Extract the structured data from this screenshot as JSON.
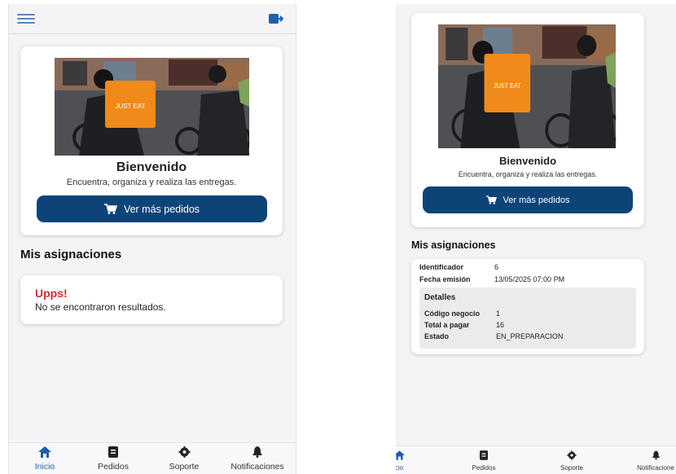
{
  "left": {
    "welcome": "Bienvenido",
    "subtitle": "Encuentra, organiza y realiza las entregas.",
    "cta": "Ver más pedidos",
    "section_title": "Mis asignaciones",
    "empty_title": "Upps!",
    "empty_text": "No se encontraron resultados.",
    "nav": [
      {
        "label": "Inicio",
        "icon": "home-icon",
        "active": true
      },
      {
        "label": "Pedidos",
        "icon": "document-icon",
        "active": false
      },
      {
        "label": "Soporte",
        "icon": "gear-icon",
        "active": false
      },
      {
        "label": "Notificaciones",
        "icon": "bell-icon",
        "active": false
      }
    ]
  },
  "right": {
    "welcome": "Bienvenido",
    "subtitle": "Encuentra, organiza y realiza las entregas.",
    "cta": "Ver más pedidos",
    "section_title": "Mis asignaciones",
    "assignment": {
      "id_label": "Identificador",
      "id_value": "6",
      "date_label": "Fecha emisión",
      "date_value": "13/05/2025 07:00 PM",
      "details_title": "Detalles",
      "code_label": "Código negocio",
      "code_value": "1",
      "total_label": "Total a pagar",
      "total_value": "16",
      "status_label": "Estado",
      "status_value": "EN_PREPARACION"
    },
    "nav": [
      {
        "label": "cio",
        "icon": "home-icon",
        "active": true
      },
      {
        "label": "Pedidos",
        "icon": "document-icon",
        "active": false
      },
      {
        "label": "Soporte",
        "icon": "gear-icon",
        "active": false
      },
      {
        "label": "Notificacione",
        "icon": "bell-icon",
        "active": false
      }
    ]
  },
  "colors": {
    "primary": "#0d4478",
    "error": "#d32f2f",
    "active_nav": "#1f5fae",
    "bag_orange": "#f08a1a"
  }
}
